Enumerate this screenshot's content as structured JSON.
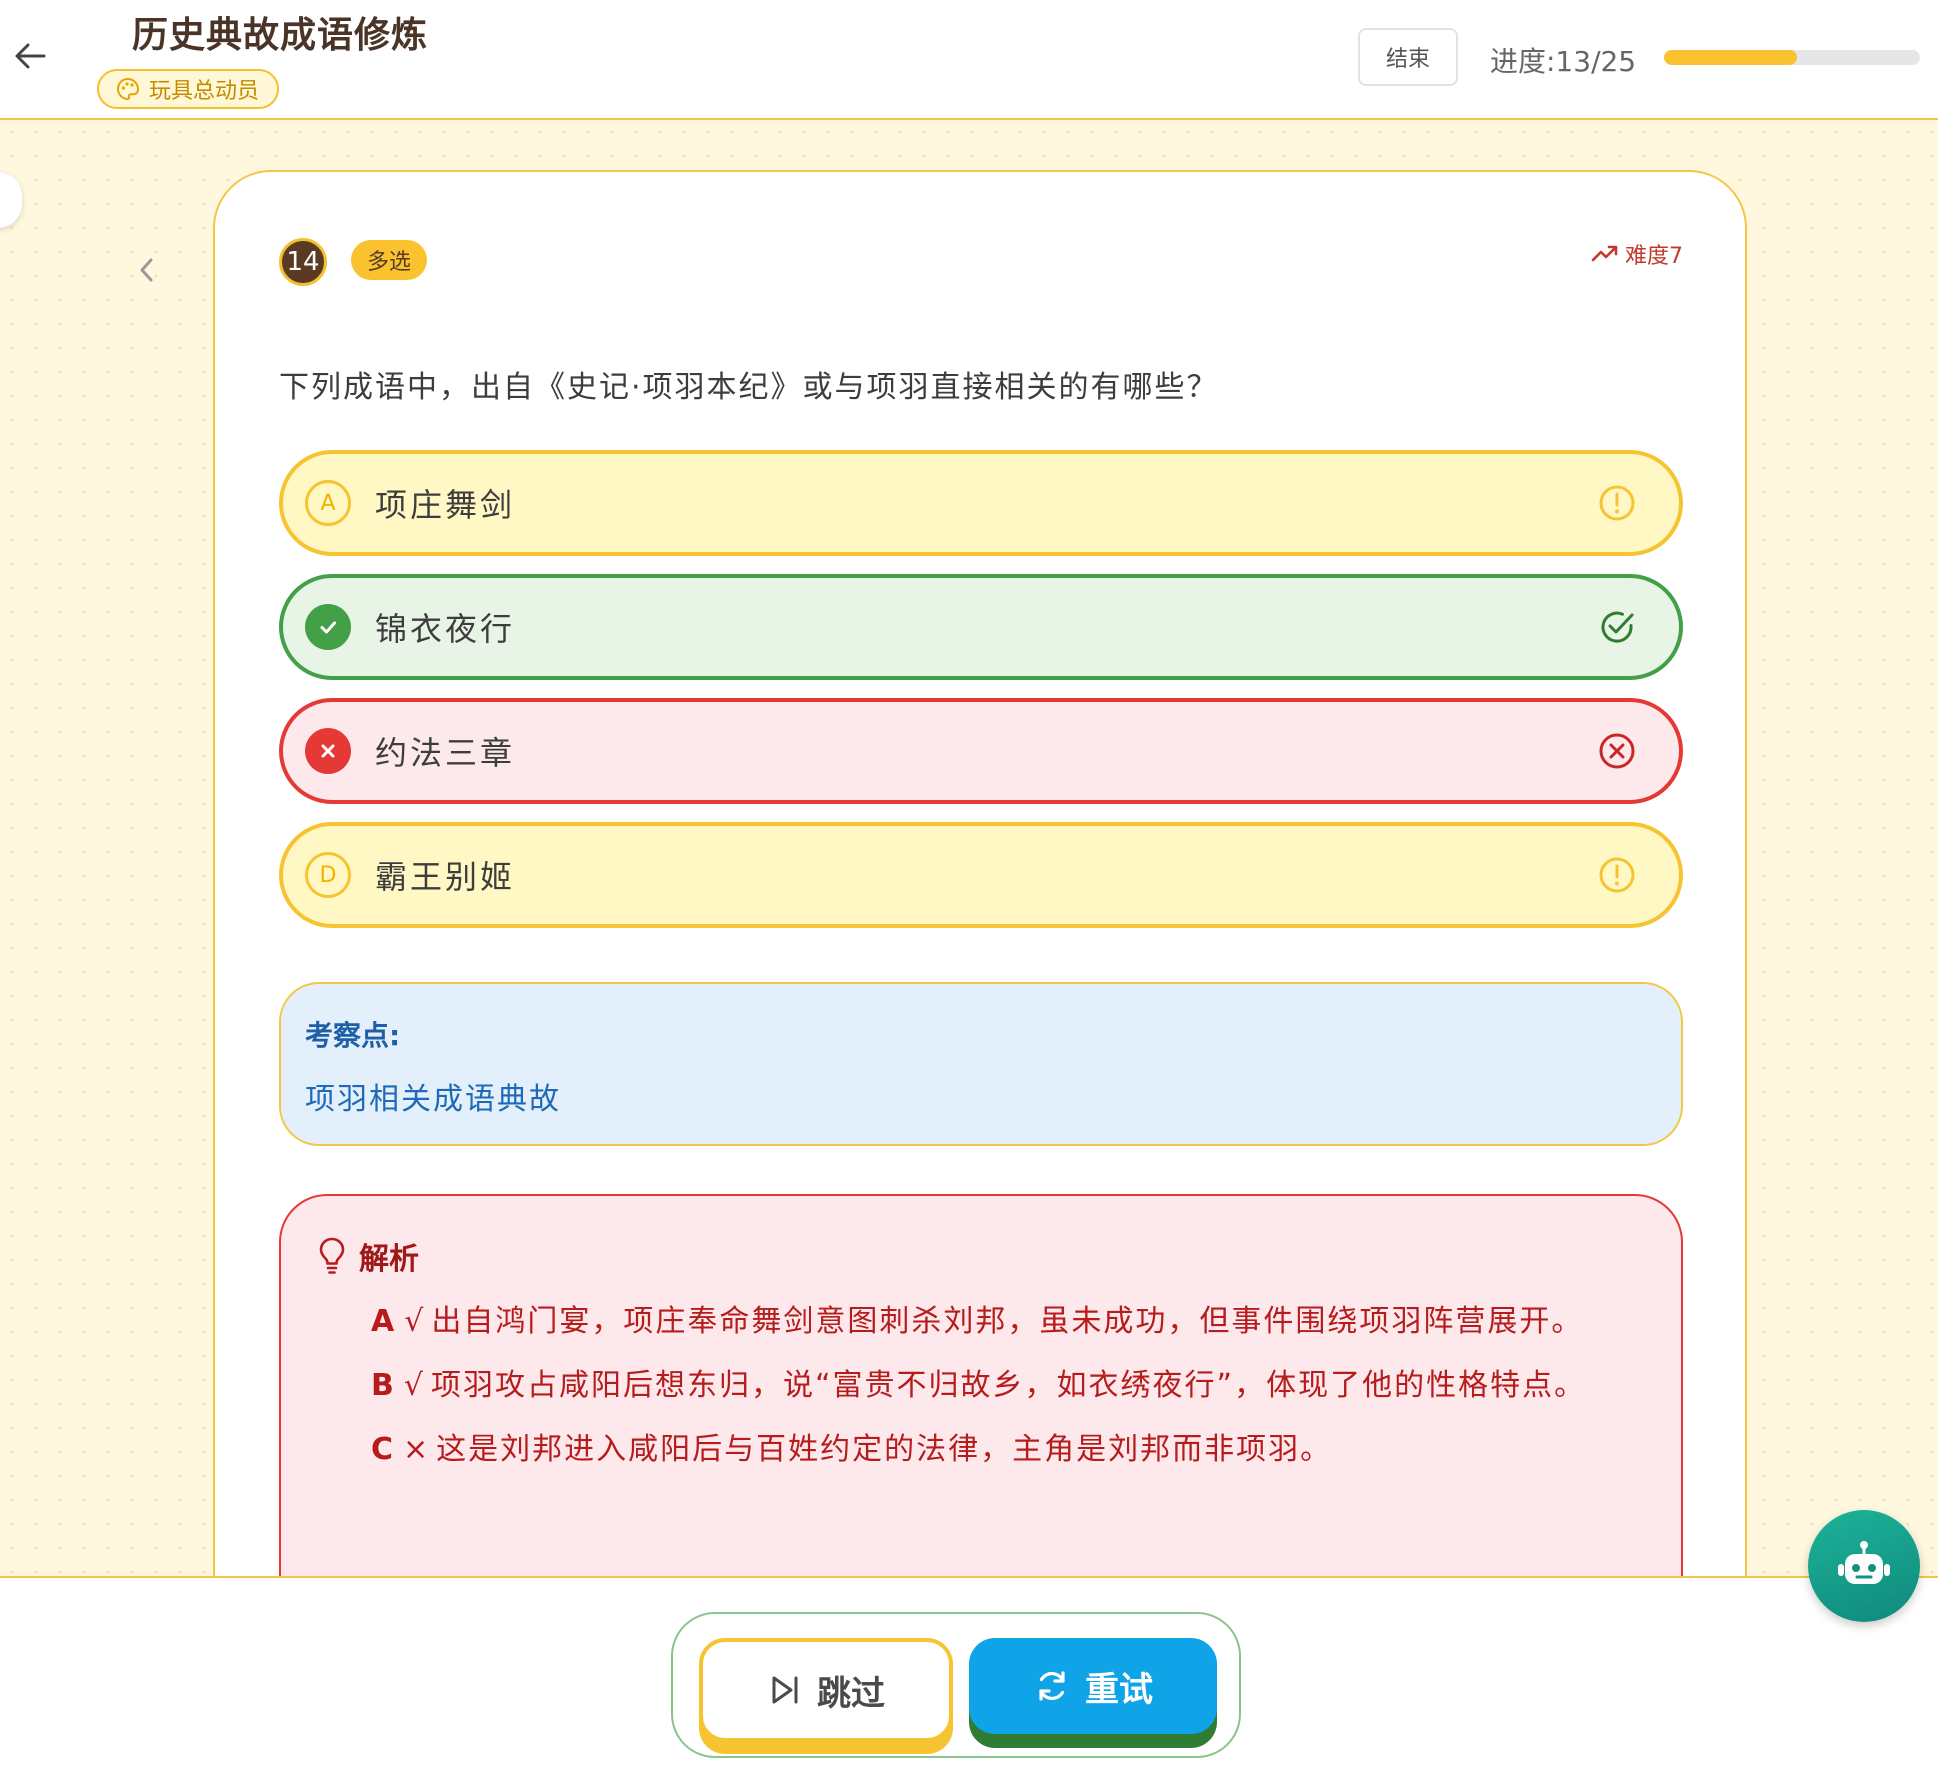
{
  "header": {
    "title": "历史典故成语修炼",
    "theme_chip": "玩具总动员",
    "end_label": "结束",
    "progress_label": "进度:13/25",
    "progress_fraction": 0.52
  },
  "question": {
    "number": "14",
    "type": "多选",
    "difficulty": "难度7",
    "text": "下列成语中，出自《史记·项羽本纪》或与项羽直接相关的有哪些？",
    "options": [
      {
        "letter": "A",
        "text": "项庄舞剑",
        "status": "missed"
      },
      {
        "letter": "B",
        "text": "锦衣夜行",
        "status": "correct"
      },
      {
        "letter": "C",
        "text": "约法三章",
        "status": "wrong"
      },
      {
        "letter": "D",
        "text": "霸王别姬",
        "status": "missed"
      }
    ]
  },
  "topic": {
    "label": "考察点:",
    "value": "项羽相关成语典故"
  },
  "analysis": {
    "title": "解析",
    "items": [
      {
        "letter": "A",
        "mark": "√",
        "text": "出自鸿门宴，项庄奉命舞剑意图刺杀刘邦，虽未成功，但事件围绕项羽阵营展开。"
      },
      {
        "letter": "B",
        "mark": "√",
        "text": "项羽攻占咸阳后想东归，说“富贵不归故乡，如衣绣夜行”，体现了他的性格特点。"
      },
      {
        "letter": "C",
        "mark": "×",
        "text": "这是刘邦进入咸阳后与百姓约定的法律，主角是刘邦而非项羽。"
      }
    ]
  },
  "actions": {
    "skip_label": "跳过",
    "retry_label": "重试"
  },
  "colors": {
    "accent_yellow": "#f7c431",
    "correct_green": "#43a047",
    "wrong_red": "#e53935",
    "retry_blue": "#0fa3e8",
    "topic_blue": "#1f5fa8"
  },
  "icons": [
    "back-arrow-icon",
    "palette-icon",
    "chevron-left-icon",
    "trend-up-icon",
    "alert-circle-icon",
    "check-circle-icon",
    "x-circle-icon",
    "lightbulb-icon",
    "skip-icon",
    "refresh-icon",
    "robot-icon"
  ]
}
